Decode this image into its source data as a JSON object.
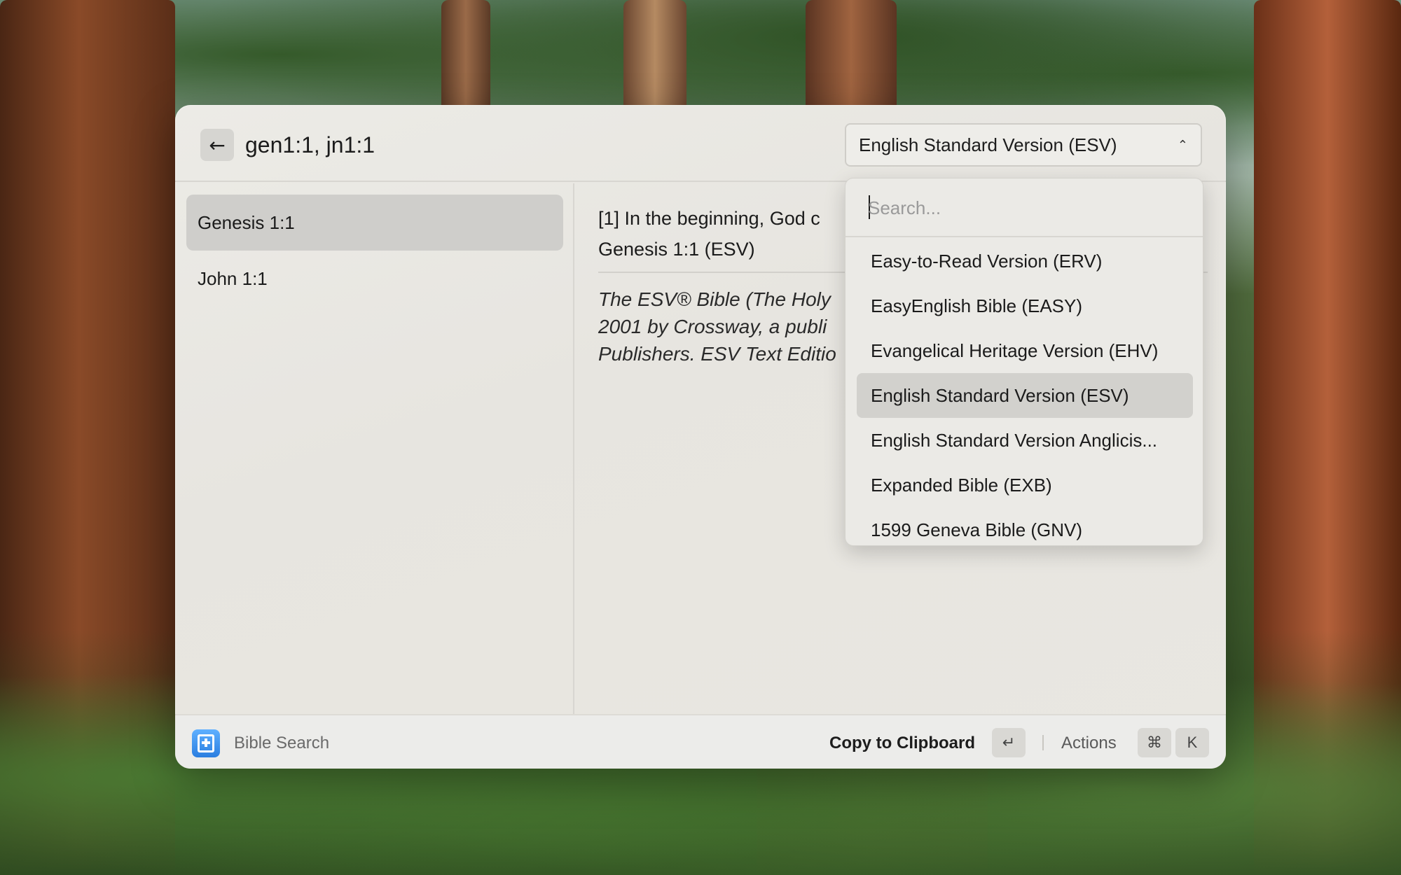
{
  "header": {
    "back_icon": "arrow-left-icon",
    "query": "gen1:1, jn1:1",
    "version_selected": "English Standard Version (ESV)",
    "chevron_icon": "chevron-up-icon"
  },
  "sidebar": {
    "items": [
      {
        "label": "Genesis 1:1",
        "selected": true
      },
      {
        "label": "John 1:1",
        "selected": false
      }
    ]
  },
  "content": {
    "verse_line": "[1] In the beginning, God c",
    "reference": "Genesis 1:1 (ESV)",
    "copyright_lines": [
      "The ESV® Bible (The Holy",
      "2001 by Crossway, a publi",
      "Publishers. ESV Text Editio"
    ]
  },
  "dropdown": {
    "search_placeholder": "Search...",
    "search_value": "",
    "options": [
      {
        "label": "Easy-to-Read Version (ERV)",
        "active": false
      },
      {
        "label": "EasyEnglish Bible (EASY)",
        "active": false
      },
      {
        "label": "Evangelical Heritage Version (EHV)",
        "active": false
      },
      {
        "label": "English Standard Version (ESV)",
        "active": true
      },
      {
        "label": "English Standard Version Anglicis...",
        "active": false
      },
      {
        "label": "Expanded Bible (EXB)",
        "active": false
      },
      {
        "label": "1599 Geneva Bible (GNV)",
        "active": false
      }
    ]
  },
  "footer": {
    "extension_icon": "bible-search-icon",
    "extension_name": "Bible Search",
    "primary_action": "Copy to Clipboard",
    "enter_key": "↵",
    "actions_label": "Actions",
    "cmd_key": "⌘",
    "k_key": "K"
  },
  "colors": {
    "window_bg": "#e9e7e1",
    "selected_bg": "#cfcecb",
    "icon_blue": "#2a7ee0"
  }
}
